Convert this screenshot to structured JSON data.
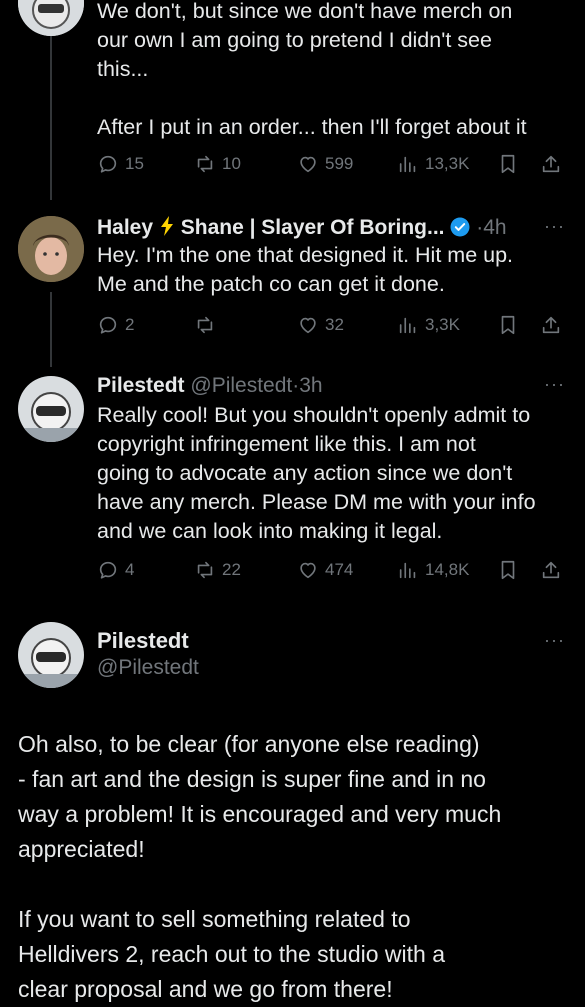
{
  "tweet1": {
    "text": "We don't, but since we don't have merch on\nour own I am going to pretend I didn't see\nthis...\n\nAfter I put in an order... then I'll forget about it",
    "replies": "15",
    "retweets": "10",
    "likes": "599",
    "views": "13,3K"
  },
  "tweet2": {
    "name": "Haley",
    "name_icon": "lightning-bolt-icon",
    "name_rest": "Shane | Slayer Of Boring...",
    "separator": "·",
    "time": "4h",
    "text": "Hey. I'm the one that designed it. Hit me up.\nMe and the patch co can get it done.",
    "replies": "2",
    "retweets": "",
    "likes": "32",
    "views": "3,3K"
  },
  "tweet3": {
    "name": "Pilestedt",
    "handle": "@Pilestedt",
    "separator": "·",
    "time": "3h",
    "text": "Really cool! But you shouldn't openly admit to\ncopyright infringement like this. I am not\ngoing to advocate any action since we don't\nhave any merch. Please DM me with your info\nand we can look into making it legal.",
    "replies": "4",
    "retweets": "22",
    "likes": "474",
    "views": "14,8K"
  },
  "tweet4": {
    "name": "Pilestedt",
    "handle": "@Pilestedt",
    "text": "Oh also, to be clear (for anyone else reading)\n- fan art and the design is super fine and in no\nway a problem! It is encouraged and very much\nappreciated!\n\nIf you want to sell something related to\nHelldivers 2, reach out to the studio with a\nclear proposal and we go from there!"
  },
  "more_label": "···",
  "colors": {
    "background": "#000000",
    "text": "#e7e9ea",
    "muted": "#71767b",
    "verified": "#1d9bf0",
    "bolt": "#ffd400"
  }
}
